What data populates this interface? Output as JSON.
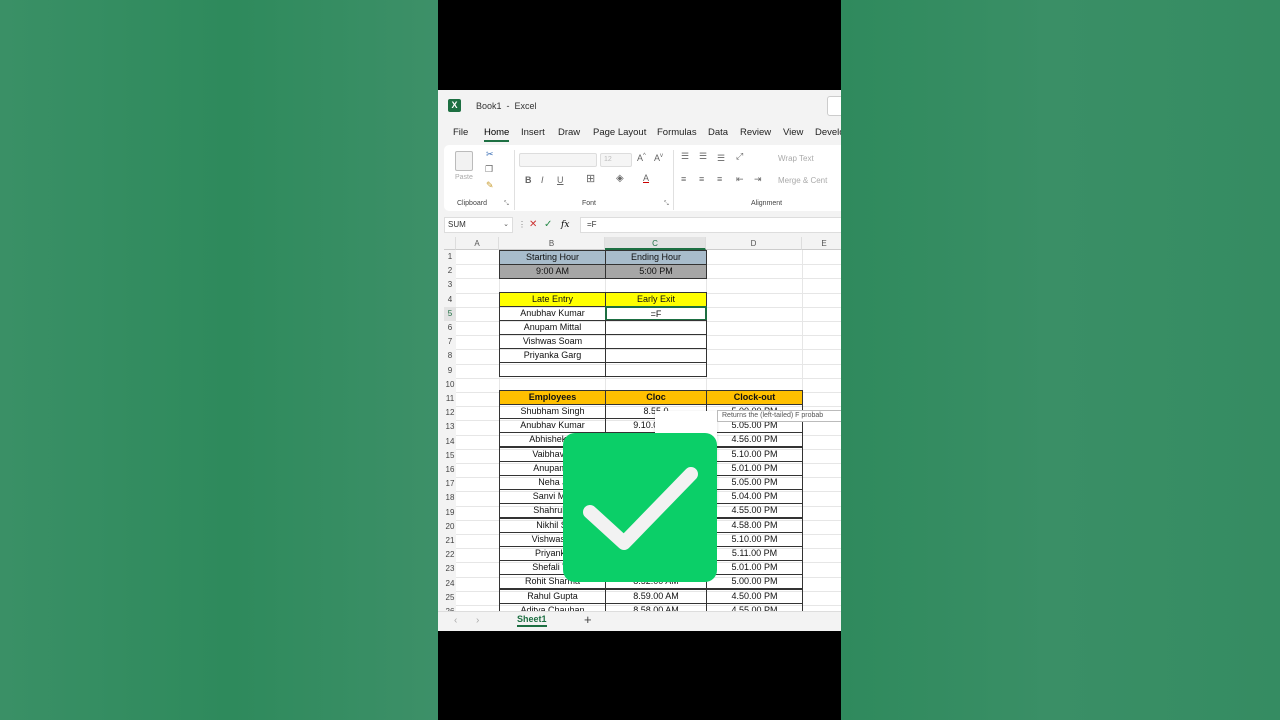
{
  "window": {
    "title": "Book1  -  Excel",
    "logo": "X"
  },
  "tabs": [
    "File",
    "Home",
    "Insert",
    "Draw",
    "Page Layout",
    "Formulas",
    "Data",
    "Review",
    "View",
    "Develo"
  ],
  "active_tab": "Home",
  "ribbon": {
    "clipboard_label": "Clipboard",
    "paste_label": "Paste",
    "font_label": "Font",
    "font_size": "12",
    "alignment_label": "Alignment",
    "wrap_text": "Wrap Text",
    "merge_center": "Merge & Cent",
    "bold": "B",
    "italic": "I",
    "underline": "U"
  },
  "formula_bar": {
    "name_box": "SUM",
    "fx": "fx",
    "formula": "=F"
  },
  "columns": [
    "A",
    "B",
    "C",
    "D",
    "E"
  ],
  "rows": [
    "1",
    "2",
    "3",
    "4",
    "5",
    "6",
    "7",
    "8",
    "9",
    "10",
    "11",
    "12",
    "13",
    "14",
    "15",
    "16",
    "17",
    "18",
    "19",
    "20",
    "21",
    "22",
    "23",
    "24",
    "25",
    "26"
  ],
  "cells": {
    "b1": "Starting Hour",
    "c1": "Ending Hour",
    "b2": "9:00 AM",
    "c2": "5:00 PM",
    "b4": "Late Entry",
    "c4": "Early Exit",
    "b5": "Anubhav Kumar",
    "c5": "=F",
    "b6": "Anupam Mittal",
    "b7": "Vishwas Soam",
    "b8": "Priyanka Garg",
    "b11": "Employees",
    "c11": "Cloc",
    "d11": "Clock-out"
  },
  "employees": [
    {
      "name": "Shubham Singh",
      "in": "8.55.0",
      "out": "5.00.00 PM"
    },
    {
      "name": "Anubhav Kumar",
      "in": "9.10.00 AM",
      "out": "5.05.00 PM"
    },
    {
      "name": "Abhishek G",
      "in": "",
      "out": "4.56.00 PM"
    },
    {
      "name": "Vaibhav K",
      "in": "",
      "out": "5.10.00 PM"
    },
    {
      "name": "Anupam I",
      "in": "",
      "out": "5.01.00 PM"
    },
    {
      "name": "Neha J",
      "in": "",
      "out": "5.05.00 PM"
    },
    {
      "name": "Sanvi Mal",
      "in": "",
      "out": "5.04.00 PM"
    },
    {
      "name": "Shahrukh",
      "in": "",
      "out": "4.55.00 PM"
    },
    {
      "name": "Nikhil Si",
      "in": "",
      "out": "4.58.00 PM"
    },
    {
      "name": "Vishwas S",
      "in": "",
      "out": "5.10.00 PM"
    },
    {
      "name": "Priyanka",
      "in": "",
      "out": "5.11.00 PM"
    },
    {
      "name": "Shefali Ve",
      "in": "",
      "out": "5.01.00 PM"
    },
    {
      "name": "Rohit Sharma",
      "in": "8.52.00 AM",
      "out": "5.00.00 PM"
    },
    {
      "name": "Rahul Gupta",
      "in": "8.59.00 AM",
      "out": "4.50.00 PM"
    },
    {
      "name": "Aditya Chauhan",
      "in": "8.58.00 AM",
      "out": "4.55.00 PM"
    }
  ],
  "tooltip": "Returns the (left-tailed) F probab",
  "sheet": {
    "name": "Sheet1",
    "add": "+"
  },
  "colors": {
    "excel_green": "#1d6f42",
    "check_green": "#0bcf68"
  }
}
